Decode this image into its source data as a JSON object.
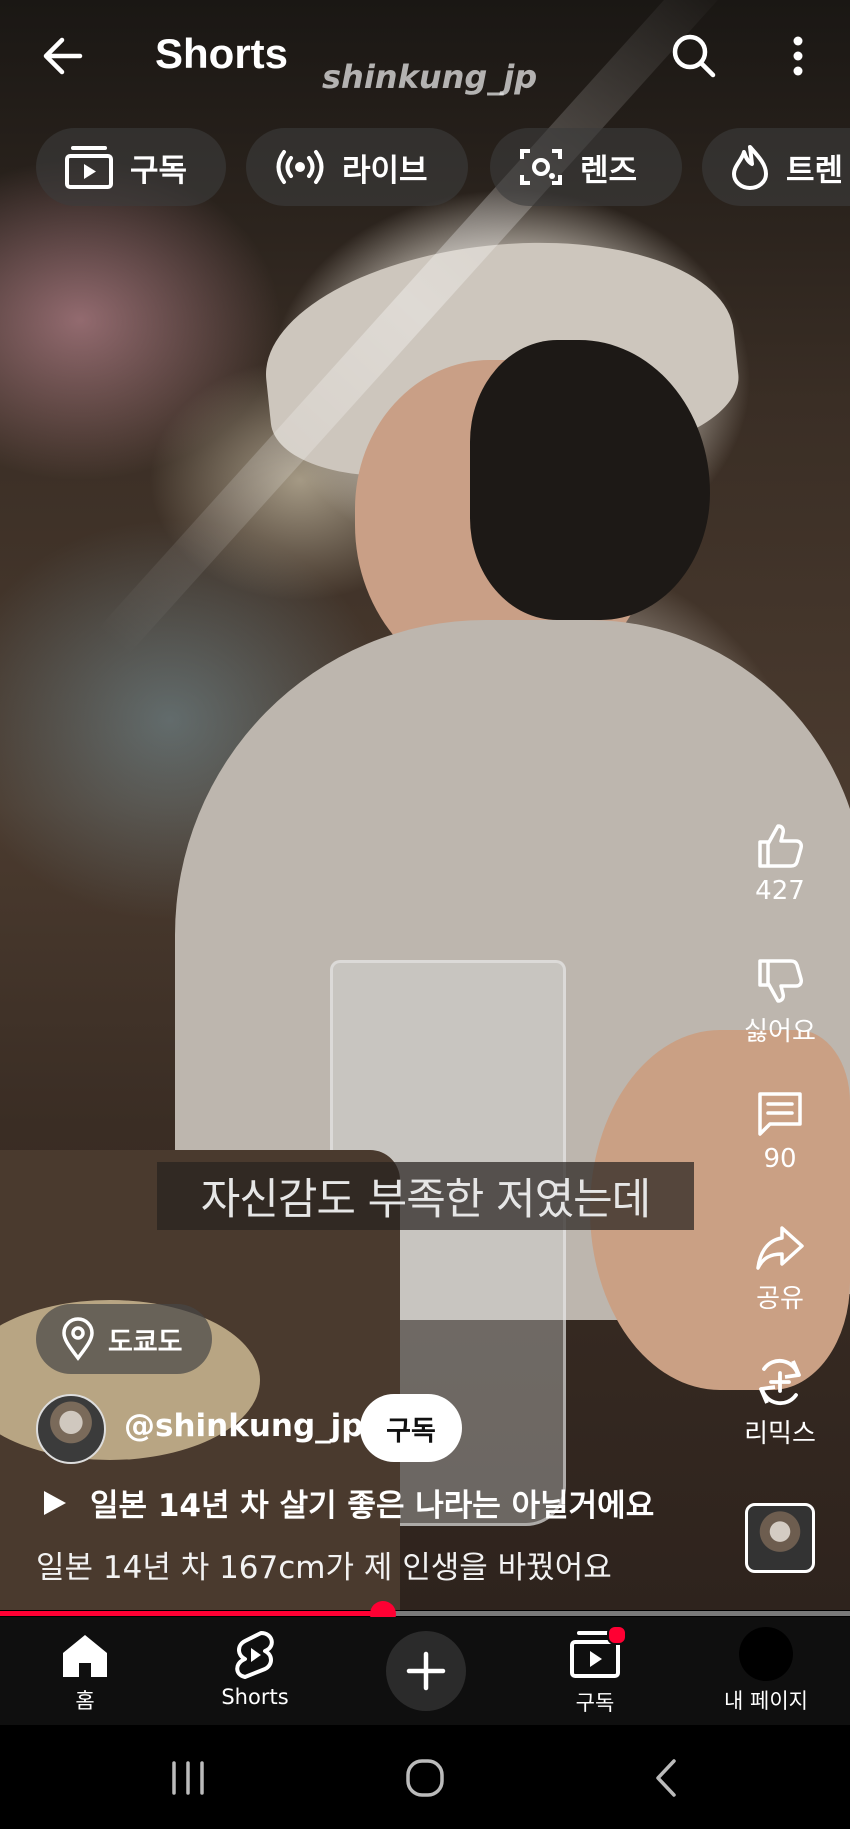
{
  "header": {
    "title": "Shorts",
    "watermark": "shinkung_jp"
  },
  "chips": [
    {
      "label": "구독",
      "icon": "subscriptions-icon"
    },
    {
      "label": "라이브",
      "icon": "live-broadcast-icon"
    },
    {
      "label": "렌즈",
      "icon": "lens-icon"
    },
    {
      "label": "트렌",
      "icon": "trending-flame-icon"
    }
  ],
  "video": {
    "caption": "자신감도 부족한 저였는데",
    "progress": 0.45
  },
  "actions": {
    "like_count": "427",
    "dislike_label": "싫어요",
    "comment_count": "90",
    "share_label": "공유",
    "remix_label": "리믹스"
  },
  "location": {
    "label": "도쿄도"
  },
  "channel": {
    "handle": "@shinkung_jp",
    "subscribe_label": "구독"
  },
  "description": {
    "linked_title": "일본 14년 차 살기 좋은 나라는 아닐거에요",
    "text": "일본 14년 차 167cm가 제 인생을 바꿨어요"
  },
  "nav": {
    "home": "홈",
    "shorts": "Shorts",
    "subscriptions": "구독",
    "my_page": "내 페이지"
  },
  "colors": {
    "accent": "#ff0033",
    "navbar": "#0f0f0f",
    "chip_bg": "#3c3c3c"
  }
}
